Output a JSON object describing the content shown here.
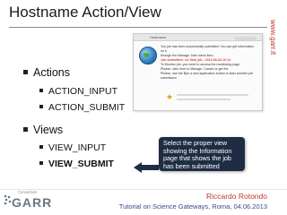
{
  "slide": {
    "title": "Hostname Action/View",
    "side_url": "www.garr.it"
  },
  "embedded_screenshot": {
    "header_text": "Hostname",
    "body_lines": [
      "You job has been successfully submitted. You can get information on it",
      "through the Manage Jobs menu item.",
      "Job submitted: ch-Task job - 2013-06-04 10:14",
      "To Monitor job, you need to access the monitoring page",
      "Please, click here to Manage, Cancel or get the",
      "Please, use the Bye a new application button to start another job submission"
    ]
  },
  "bullets": {
    "actions": {
      "label": "Actions",
      "items": [
        "ACTION_INPUT",
        "ACTION_SUBMIT"
      ]
    },
    "views": {
      "label": "Views",
      "items": [
        "VIEW_INPUT",
        "VIEW_SUBMIT"
      ]
    }
  },
  "callout": {
    "text": "Select the proper view showing the Information page that shows the job has been submitted",
    "background": "#1f2d44"
  },
  "footer": {
    "logo_small": "Consortium",
    "logo_main": "GARR",
    "author": "Riccardo Rotondo",
    "event": "Tutorial on Science Gateways, Roma, 04.06.2013"
  },
  "colors": {
    "accent_red": "#c0392b",
    "event_blue": "#3b4a8a"
  }
}
